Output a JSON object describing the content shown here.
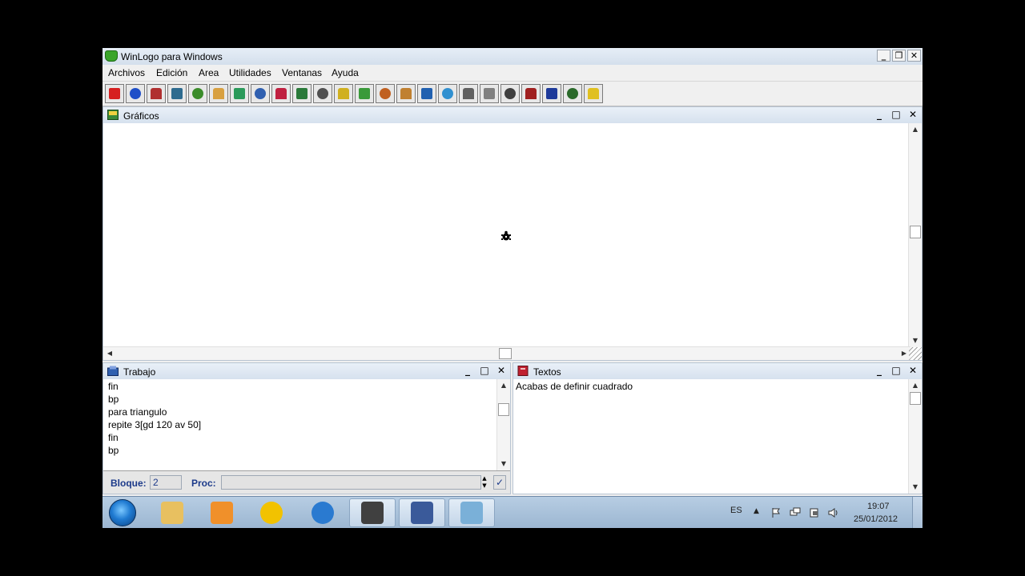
{
  "app": {
    "title": "WinLogo para Windows"
  },
  "window_buttons": {
    "minimize": "_",
    "restore": "❐",
    "close": "✕"
  },
  "menu": [
    "Archivos",
    "Edición",
    "Area",
    "Utilidades",
    "Ventanas",
    "Ayuda"
  ],
  "toolbar": {
    "icons": [
      "new-file-icon",
      "save-file-icon",
      "print-icon",
      "calculator-icon",
      "tree-icon",
      "palette-icon",
      "text-tt-icon",
      "editor-icon",
      "book-icon",
      "picture-icon",
      "notepad-icon",
      "magic-wand-icon",
      "pencil-icon",
      "house-icon",
      "brush-icon",
      "zoom-icon",
      "globe-icon",
      "star-shape-icon",
      "ruler-icon",
      "stamp-icon",
      "fireworks-icon",
      "flower-icon",
      "turtle-icon",
      "help-icon"
    ],
    "colors": [
      "#d62020",
      "#1f4fc8",
      "#b03030",
      "#2e6b8f",
      "#3b8c2a",
      "#d8a040",
      "#2a9a5a",
      "#3060b0",
      "#c02040",
      "#2a7a3a",
      "#505050",
      "#d0b020",
      "#3a9a3a",
      "#c06020",
      "#c08030",
      "#2060b0",
      "#3090d0",
      "#606060",
      "#808080",
      "#404040",
      "#a02020",
      "#1e3a9a",
      "#2a6a2a",
      "#e0c020"
    ]
  },
  "graphics_window": {
    "title": "Gráficos"
  },
  "work_window": {
    "title": "Trabajo",
    "lines": [
      "fin",
      "bp",
      "para triangulo",
      "repite 3[gd 120 av 50]",
      "fin",
      "bp"
    ],
    "block_label": "Bloque:",
    "block_value": "2",
    "proc_label": "Proc:",
    "proc_value": ""
  },
  "text_window": {
    "title": "Textos",
    "lines": [
      "Acabas de definir cuadrado"
    ]
  },
  "taskbar": {
    "apps": [
      {
        "name": "explorer",
        "icon": "folder-icon",
        "color": "#e8c060",
        "active": false
      },
      {
        "name": "media",
        "icon": "media-player-icon",
        "color": "#f0902a",
        "active": false
      },
      {
        "name": "tool",
        "icon": "yellow-arrows-icon",
        "color": "#f2c200",
        "active": false
      },
      {
        "name": "ie",
        "icon": "internet-explorer-icon",
        "color": "#2a7ad0",
        "active": false
      },
      {
        "name": "camera",
        "icon": "video-camera-icon",
        "color": "#404040",
        "active": true
      },
      {
        "name": "winlogo",
        "icon": "window-app-icon",
        "color": "#3a5a9a",
        "active": true
      },
      {
        "name": "note",
        "icon": "notepad-icon",
        "color": "#7ab0d8",
        "active": true
      }
    ],
    "lang": "ES",
    "time": "19:07",
    "date": "25/01/2012"
  }
}
